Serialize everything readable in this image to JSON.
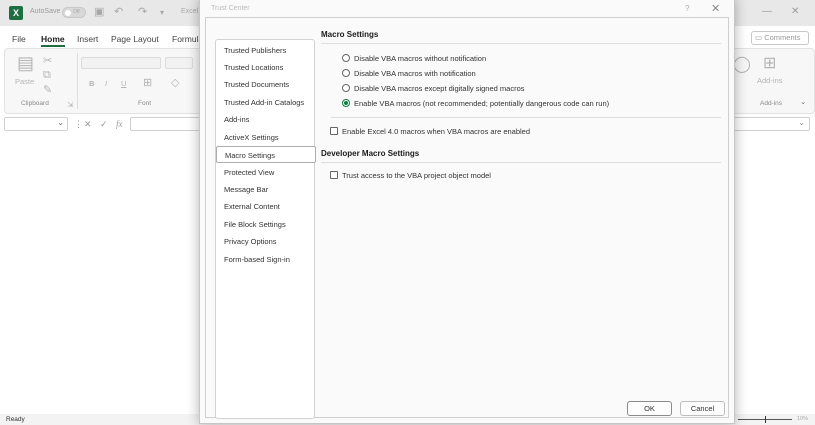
{
  "excel": {
    "logo_letter": "X",
    "autosave_label": "AutoSave",
    "autosave_state": "Off",
    "title_fragment": "Excel",
    "menu": [
      "File",
      "Home",
      "Insert",
      "Page Layout",
      "Formula"
    ],
    "active_menu": "Home",
    "comments_label": "Comments",
    "ribbon": {
      "paste_label": "Paste",
      "clipboard_group": "Clipboard",
      "font_group": "Font",
      "addins_label": "Add-ins",
      "addins_group": "Add-ins",
      "bold": "B",
      "italic": "I",
      "underline": "U"
    },
    "formula": {
      "fx": "fx"
    },
    "status": {
      "ready": "Ready",
      "zoom": "10%"
    }
  },
  "dialog": {
    "title": "Trust Center",
    "help": "?",
    "close": "✕",
    "nav": [
      "Trusted Publishers",
      "Trusted Locations",
      "Trusted Documents",
      "Trusted Add-in Catalogs",
      "Add-ins",
      "ActiveX Settings",
      "Macro Settings",
      "Protected View",
      "Message Bar",
      "External Content",
      "File Block Settings",
      "Privacy Options",
      "Form-based Sign-in"
    ],
    "selected_nav": "Macro Settings",
    "macro": {
      "heading": "Macro Settings",
      "options": [
        "Disable VBA macros without notification",
        "Disable VBA macros with notification",
        "Disable VBA macros except digitally signed macros",
        "Enable VBA macros (not recommended; potentially dangerous code can run)"
      ],
      "selected_option": "Enable VBA macros (not recommended; potentially dangerous code can run)",
      "excel4_checkbox": "Enable Excel 4.0 macros when VBA macros are enabled",
      "excel4_checked": false
    },
    "developer": {
      "heading": "Developer Macro Settings",
      "vba_checkbox": "Trust access to the VBA project object model",
      "vba_checked": false
    },
    "ok": "OK",
    "cancel": "Cancel"
  },
  "colors": {
    "accent": "#107c41",
    "excel_green": "#1d6f42"
  }
}
